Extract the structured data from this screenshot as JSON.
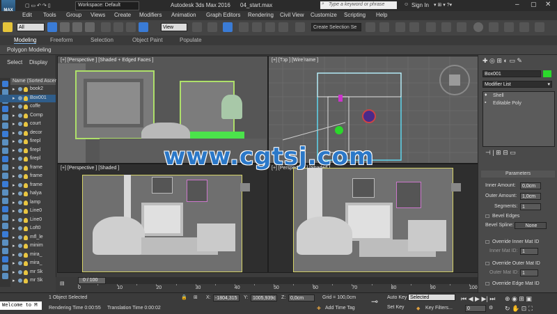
{
  "app": {
    "title": "Autodesk 3ds Max 2016",
    "file": "04_start.max",
    "workspace_label": "Workspace: Default",
    "search_placeholder": "Type a keyword or phrase",
    "sign_in": "Sign In",
    "logo": "MAX"
  },
  "menu": [
    "Edit",
    "Tools",
    "Group",
    "Views",
    "Create",
    "Modifiers",
    "Animation",
    "Graph Editors",
    "Rendering",
    "Civil View",
    "Customize",
    "Scripting",
    "Help"
  ],
  "toolbar": {
    "filter_value": "All",
    "refcoord_value": "View",
    "selection_set_value": "Create Selection Se"
  },
  "ribbon": {
    "tabs": [
      "Modeling",
      "Freeform",
      "Selection",
      "Object Paint",
      "Populate"
    ],
    "sub_label": "Polygon Modeling"
  },
  "explorer": {
    "tabs": [
      "Select",
      "Display"
    ],
    "header": "Name (Sorted Ascer",
    "rows": [
      "book2",
      "Box001",
      "coffe",
      "Comp",
      "court",
      "decor",
      "firepl",
      "firepl",
      "firepl",
      "frame",
      "frame",
      "frame",
      "halya",
      "lamp",
      "Line0",
      "Line0",
      "Loft0",
      "mfl_le",
      "minim",
      "mira_",
      "mira_",
      "mr Sk",
      "mr Sk"
    ]
  },
  "viewports": {
    "top_left": "[+] [Perspective ] [Shaded + Edged Faces ]",
    "top_right": "[+] [Top ] [Wireframe ]",
    "bottom_left": "[+] [Perspective ] [Shaded ]",
    "bottom_right": "[+] [Perspective ] [Shaded ]"
  },
  "watermark": "www.cgtsj.com",
  "command_panel": {
    "object_name": "Box001",
    "modifier_list": "Modifier List",
    "stack": [
      "Shell",
      "Editable Poly"
    ],
    "rollout_title": "Parameters",
    "inner_amount_label": "Inner Amount:",
    "inner_amount": "0,0cm",
    "outer_amount_label": "Outer Amount:",
    "outer_amount": "1,0cm",
    "segments_label": "Segments:",
    "segments": "1",
    "bevel_edges": "Bevel Edges",
    "bevel_spline_label": "Bevel Spline:",
    "bevel_spline_value": "None",
    "override_inner": "Override Inner Mat ID",
    "inner_mat_label": "Inner Mat ID:",
    "inner_mat_value": "1",
    "override_outer": "Override Outer Mat ID",
    "outer_mat_label": "Outer Mat ID:",
    "outer_mat_value": "1",
    "override_edge": "Override Edge Mat ID"
  },
  "timeline": {
    "frame_display": "0 / 100",
    "ticks": [
      "0",
      "10",
      "20",
      "30",
      "40",
      "50",
      "60",
      "70",
      "80",
      "90",
      "100"
    ],
    "current_frame_fraction": 0
  },
  "status": {
    "console": "Welcome to M",
    "selection": "1 Object Selected",
    "rendering_time": "Rendering Time  0:00:55",
    "translation_time": "Translation Time  0:00:02",
    "x_value": "-1804,315",
    "y_value": "1005,939c",
    "z_value": "0,0cm",
    "grid": "Grid = 100,0cm",
    "add_time_tag": "Add Time Tag",
    "auto_key": "Auto Key",
    "set_key": "Set Key",
    "selected_value": "Selected",
    "key_filters": "Key Filters...",
    "frame_value": "0"
  },
  "colors": {
    "accent_blue": "#5aa0e0",
    "selection_green": "#2bd82b",
    "viewport_border_yellow": "#d7d468",
    "auto_key_red": "#a03030"
  }
}
